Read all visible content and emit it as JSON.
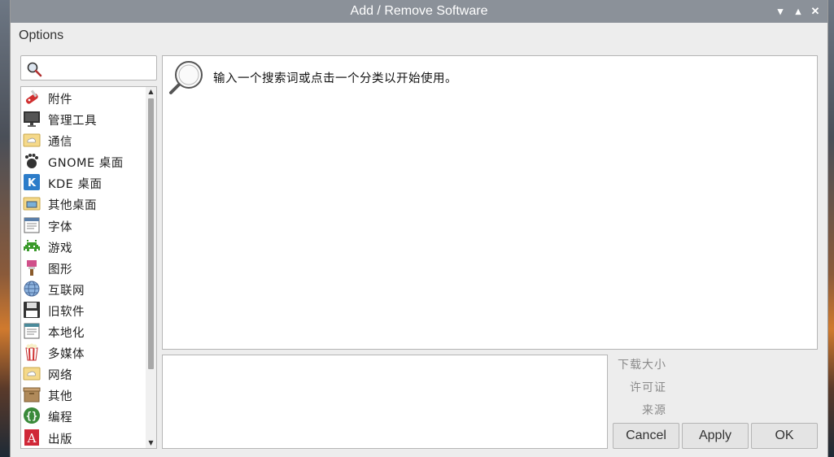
{
  "window": {
    "title": "Add / Remove Software",
    "controls": {
      "minimize": "▾",
      "maximize": "▴",
      "close": "✕"
    }
  },
  "menubar": {
    "options": "Options"
  },
  "search": {
    "value": "",
    "icon": "search-icon"
  },
  "categories": [
    {
      "label": "附件",
      "icon": "swiss-knife-icon"
    },
    {
      "label": "管理工具",
      "icon": "monitor-icon"
    },
    {
      "label": "通信",
      "icon": "cloud-folder-icon"
    },
    {
      "label": "GNOME 桌面",
      "icon": "gnome-foot-icon"
    },
    {
      "label": "KDE 桌面",
      "icon": "kde-icon"
    },
    {
      "label": "其他桌面",
      "icon": "desktop-folder-icon"
    },
    {
      "label": "字体",
      "icon": "font-document-icon"
    },
    {
      "label": "游戏",
      "icon": "space-invader-icon"
    },
    {
      "label": "图形",
      "icon": "paintbrush-icon"
    },
    {
      "label": "互联网",
      "icon": "globe-icon"
    },
    {
      "label": "旧软件",
      "icon": "floppy-disk-icon"
    },
    {
      "label": "本地化",
      "icon": "locale-document-icon"
    },
    {
      "label": "多媒体",
      "icon": "popcorn-icon"
    },
    {
      "label": "网络",
      "icon": "network-folder-icon"
    },
    {
      "label": "其他",
      "icon": "box-icon"
    },
    {
      "label": "编程",
      "icon": "braces-icon"
    },
    {
      "label": "出版",
      "icon": "publishing-icon"
    }
  ],
  "results": {
    "hint": "输入一个搜索词或点击一个分类以开始使用。"
  },
  "info": {
    "download_size": "下载大小",
    "license": "许可证",
    "source": "来源"
  },
  "buttons": {
    "cancel": "Cancel",
    "apply": "Apply",
    "ok": "OK"
  },
  "colors": {
    "titlebar": "#8b9199",
    "window_bg": "#ededed",
    "label_gray": "#8a8a8a"
  }
}
